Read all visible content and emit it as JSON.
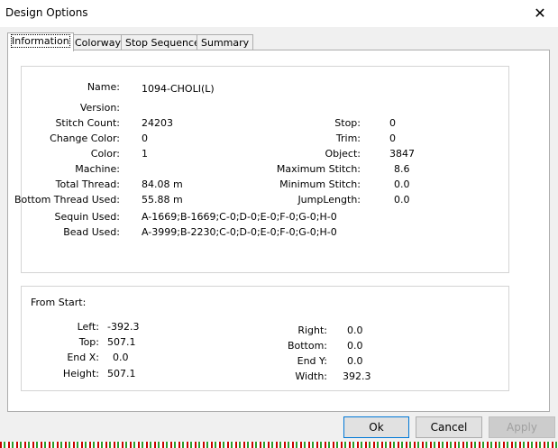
{
  "window": {
    "title": "Design Options"
  },
  "tabs": [
    {
      "label": "Information"
    },
    {
      "label": "Colorway"
    },
    {
      "label": "Stop Sequence"
    },
    {
      "label": "Summary"
    }
  ],
  "info": {
    "left": [
      {
        "label": "Name:",
        "value": "1094-CHOLI(L)"
      },
      {
        "label": "Version:",
        "value": ""
      },
      {
        "label": "Stitch Count:",
        "value": "24203"
      },
      {
        "label": "Change Color:",
        "value": "0"
      },
      {
        "label": "Color:",
        "value": "1"
      },
      {
        "label": "Machine:",
        "value": ""
      },
      {
        "label": "Total Thread:",
        "value": "84.08 m"
      },
      {
        "label": "Bottom Thread Used:",
        "value": "55.88 m"
      },
      {
        "label": "Sequin Used:",
        "value": "A-1669;B-1669;C-0;D-0;E-0;F-0;G-0;H-0"
      },
      {
        "label": "Bead Used:",
        "value": "A-3999;B-2230;C-0;D-0;E-0;F-0;G-0;H-0"
      }
    ],
    "right": [
      {
        "label": "Stop:",
        "value": "0"
      },
      {
        "label": "Trim:",
        "value": "0"
      },
      {
        "label": "Object:",
        "value": "3847"
      },
      {
        "label": "Maximum Stitch:",
        "value": "8.6"
      },
      {
        "label": "Minimum Stitch:",
        "value": "0.0"
      },
      {
        "label": "JumpLength:",
        "value": "0.0"
      }
    ]
  },
  "from_start": {
    "heading": "From Start:",
    "left": [
      {
        "label": "Left:",
        "value": "-392.3"
      },
      {
        "label": "Top:",
        "value": "507.1"
      },
      {
        "label": "End X:",
        "value": "0.0"
      },
      {
        "label": "Height:",
        "value": "507.1"
      }
    ],
    "right": [
      {
        "label": "Right:",
        "value": "0.0"
      },
      {
        "label": "Bottom:",
        "value": "0.0"
      },
      {
        "label": "End Y:",
        "value": "0.0"
      },
      {
        "label": "Width:",
        "value": "392.3"
      }
    ]
  },
  "buttons": {
    "ok": "Ok",
    "cancel": "Cancel",
    "apply": "Apply"
  }
}
